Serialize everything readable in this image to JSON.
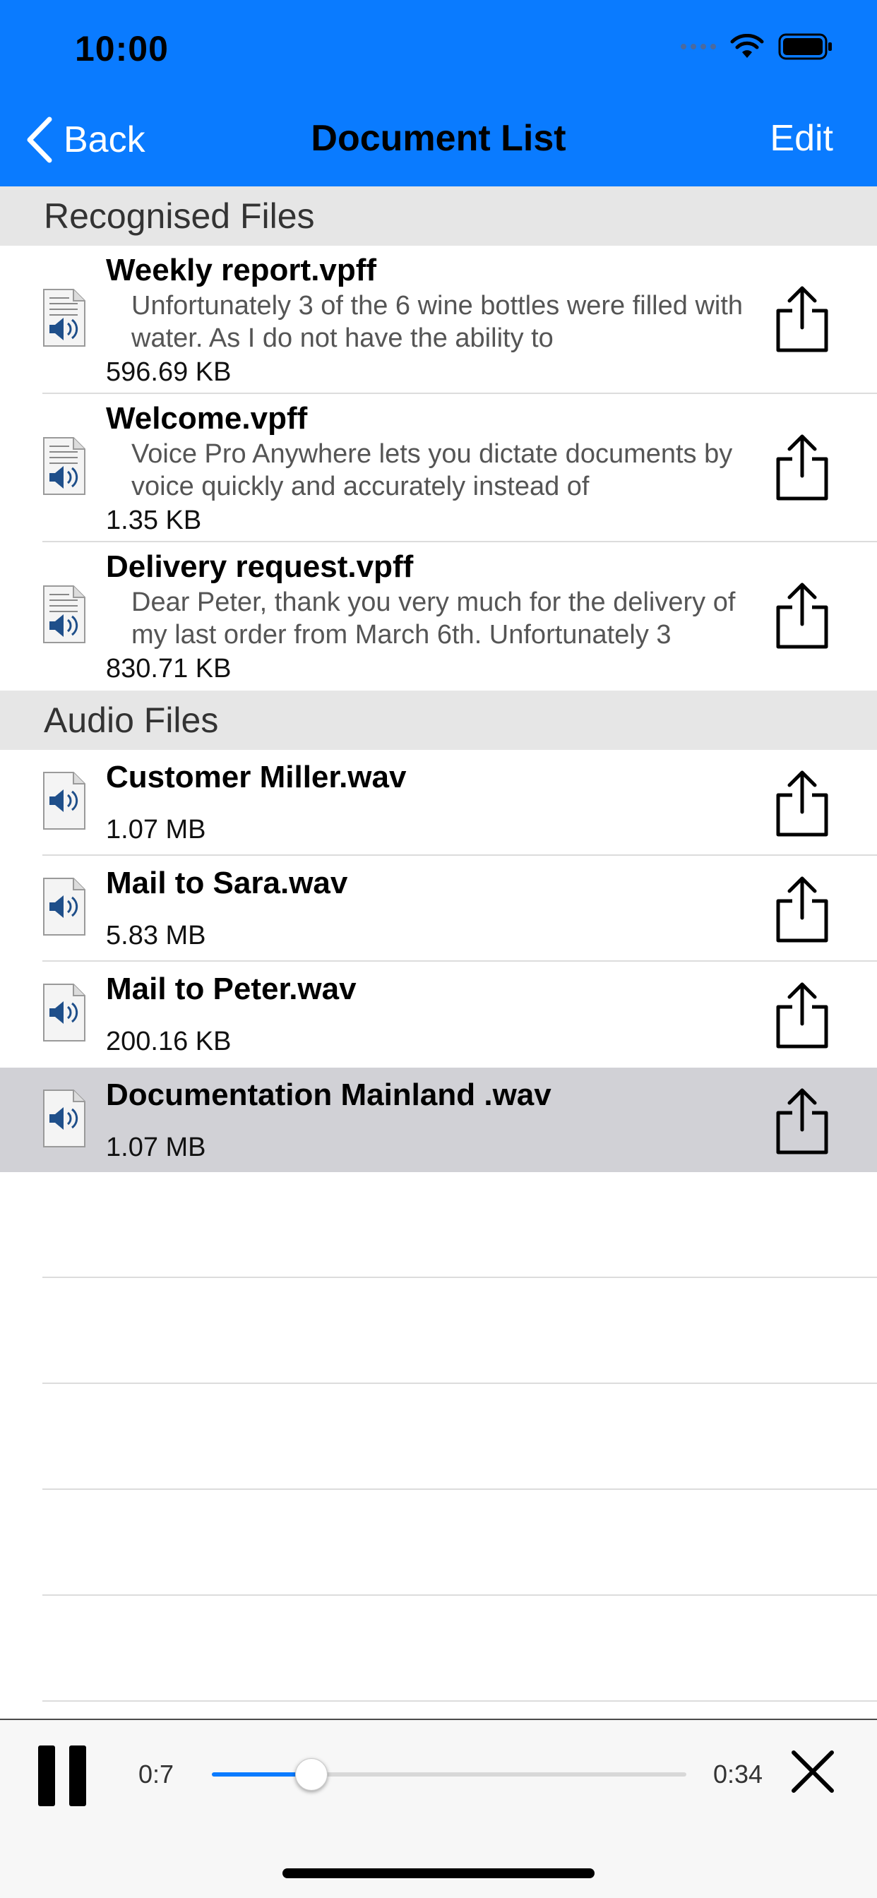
{
  "status_bar": {
    "time": "10:00"
  },
  "nav": {
    "back_label": "Back",
    "title": "Document List",
    "edit_label": "Edit"
  },
  "sections": [
    {
      "header": "Recognised Files",
      "items": [
        {
          "title": "Weekly report.vpff",
          "description": "Unfortunately 3 of the 6 wine bottles were filled with water. As I do not have the ability to",
          "size": "596.69 KB"
        },
        {
          "title": "Welcome.vpff",
          "description": "Voice Pro Anywhere lets you dictate documents by voice quickly and accurately instead of",
          "size": "1.35 KB"
        },
        {
          "title": "Delivery request.vpff",
          "description": "Dear Peter, thank you very much for the delivery of my last order from March 6th. Unfortunately 3",
          "size": "830.71 KB"
        }
      ]
    },
    {
      "header": "Audio Files",
      "items": [
        {
          "title": "Customer Miller.wav",
          "size": "1.07 MB"
        },
        {
          "title": "Mail to Sara.wav",
          "size": "5.83 MB"
        },
        {
          "title": "Mail to Peter.wav",
          "size": "200.16 KB"
        },
        {
          "title": "Documentation Mainland .wav",
          "size": "1.07 MB",
          "selected": true
        }
      ]
    }
  ],
  "player": {
    "current_time": "0:7",
    "total_time": "0:34",
    "progress_fraction": 0.21
  },
  "colors": {
    "accent": "#0a7bff",
    "selected_row": "#d1d1d6",
    "section_bg": "#e6e6e6"
  }
}
